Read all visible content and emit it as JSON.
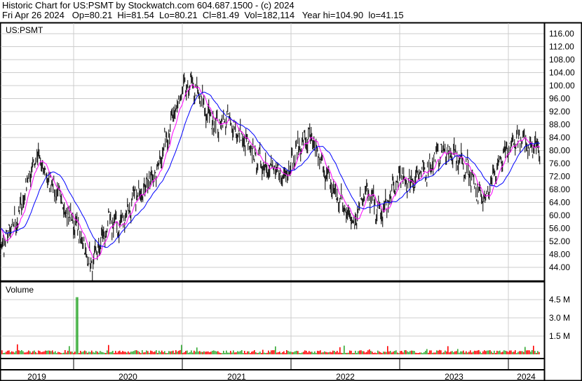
{
  "header": {
    "title": "Historic Chart for US:PSMT by Stockwatch.com 604.687.1500 - (c) 2024",
    "quote": "Fri Apr 26 2024   Op=80.21  Hi=81.54  Lo=80.21  Cl=81.49  Vol=182,114   Year hi=104.90  lo=41.15"
  },
  "chart_data": {
    "type": "line",
    "symbol": "US:PSMT",
    "volume_label": "Volume",
    "price_ticks": [
      116,
      112,
      108,
      104,
      100,
      96,
      92,
      88,
      84,
      80,
      76,
      72,
      68,
      64,
      60,
      56,
      52,
      48,
      44
    ],
    "ylim": [
      44,
      116
    ],
    "volume_ticks": [
      {
        "v": 4.5,
        "label": "4.5 M"
      },
      {
        "v": 3.0,
        "label": "3.0 M"
      },
      {
        "v": 1.5,
        "label": "1.5 M"
      }
    ],
    "years": [
      "2019",
      "2020",
      "2021",
      "2022",
      "2023",
      "2024"
    ],
    "start_month": "2019-04",
    "monthly_close": [
      62,
      50,
      55,
      60,
      72,
      78,
      72,
      68,
      62,
      58,
      52,
      44,
      52,
      58,
      56,
      62,
      66,
      70,
      72,
      82,
      90,
      98,
      100,
      96,
      90,
      88,
      90,
      86,
      82,
      78,
      76,
      74,
      72,
      76,
      82,
      84,
      78,
      72,
      66,
      62,
      58,
      68,
      64,
      60,
      66,
      72,
      70,
      72,
      74,
      78,
      80,
      78,
      76,
      72,
      64,
      70,
      76,
      80,
      84,
      82,
      81.5
    ],
    "moving_averages": [
      {
        "name": "short",
        "color": "#ff00ff"
      },
      {
        "name": "long",
        "color": "#0000ff"
      }
    ],
    "volume_spike": {
      "month": "2020-01",
      "value": 4.7
    },
    "colors": {
      "up": "#33aa33",
      "down": "#ff0000",
      "price": "#000000",
      "grid": "#cccccc"
    }
  }
}
